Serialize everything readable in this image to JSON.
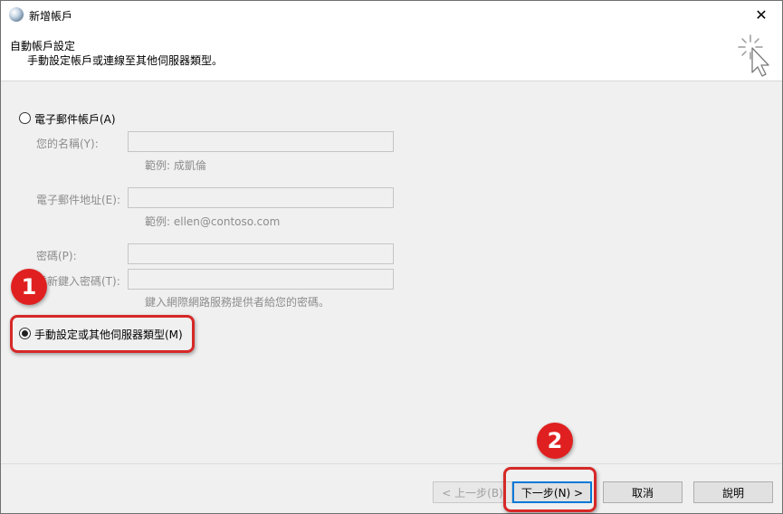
{
  "window": {
    "title": "新增帳戶",
    "close_glyph": "✕"
  },
  "header": {
    "title": "自動帳戶設定",
    "subtitle": "手動設定帳戶或連線至其他伺服器類型。",
    "icon": "cursor-sparkle-icon"
  },
  "options": {
    "email_account": {
      "label": "電子郵件帳戶(A)",
      "selected": false
    },
    "manual_setup": {
      "label": "手動設定或其他伺服器類型(M)",
      "selected": true
    }
  },
  "form": {
    "name": {
      "label": "您的名稱(Y):",
      "value": "",
      "hint": "範例: 成凱倫"
    },
    "email": {
      "label": "電子郵件地址(E):",
      "value": "",
      "hint": "範例: ellen@contoso.com"
    },
    "password": {
      "label": "密碼(P):",
      "value": ""
    },
    "retype_password": {
      "label": "重新鍵入密碼(T):",
      "value": "",
      "hint": "鍵入網際網路服務提供者給您的密碼。"
    }
  },
  "buttons": {
    "back": "< 上一步(B)",
    "next": "下一步(N) >",
    "cancel": "取消",
    "help": "說明"
  },
  "annotations": {
    "step1": "1",
    "step2": "2",
    "color": "#d62828"
  }
}
